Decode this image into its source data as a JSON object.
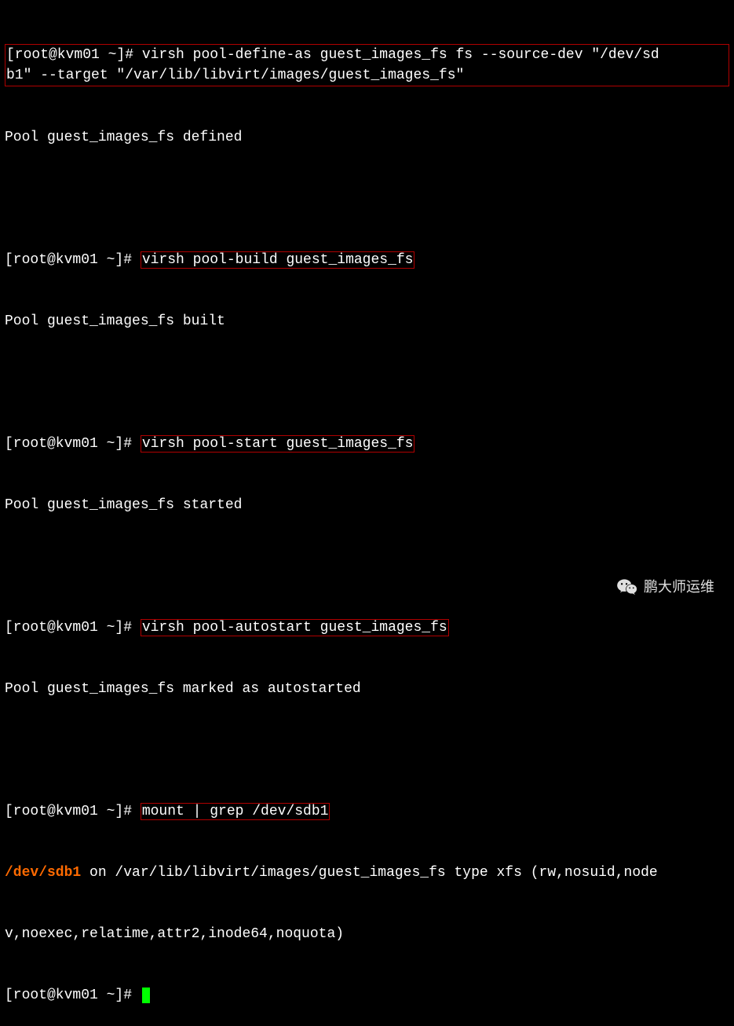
{
  "prompt": "[root@kvm01 ~]# ",
  "commands": {
    "define_line1": "virsh pool-define-as guest_images_fs fs --source-dev \"/dev/sd",
    "define_line2": "b1\" --target \"/var/lib/libvirt/images/guest_images_fs\"",
    "define_output": "Pool guest_images_fs defined",
    "build": "virsh pool-build guest_images_fs",
    "build_output": "Pool guest_images_fs built",
    "start": "virsh pool-start guest_images_fs",
    "start_output": "Pool guest_images_fs started",
    "autostart": "virsh pool-autostart guest_images_fs",
    "autostart_output": "Pool guest_images_fs marked as autostarted",
    "mount": "mount | grep /dev/sdb1",
    "mount_dev": "/dev/sdb1",
    "mount_rest_line1": " on /var/lib/libvirt/images/guest_images_fs type xfs (rw,nosuid,node",
    "mount_rest_line2": "v,noexec,relatime,attr2,inode64,noquota)"
  },
  "watermark": "鹏大师运维"
}
